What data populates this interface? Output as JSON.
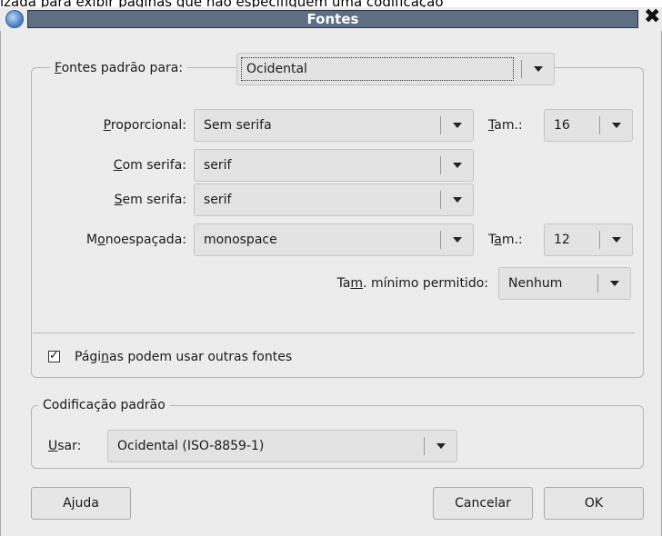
{
  "background_text": "izada para exibir páginas que não especifiquem uma codificação",
  "window": {
    "title": "Fontes",
    "close_glyph": "✖"
  },
  "fonts_group": {
    "legend_prefix": "",
    "legend_key": "F",
    "legend_rest": "ontes padrão para:",
    "for_value": "Ocidental",
    "proportional": {
      "label_key": "P",
      "label_rest": "roporcional:",
      "value": "Sem serifa",
      "size_label_key": "T",
      "size_label_rest": "am.:",
      "size_value": "16"
    },
    "serif": {
      "label_key": "C",
      "label_rest": "om serifa:",
      "value": "serif"
    },
    "sans_serif": {
      "label_key": "S",
      "label_rest": "em serifa:",
      "value": "serif"
    },
    "monospace": {
      "label_pre": "M",
      "label_key": "o",
      "label_rest": "noespaçada:",
      "value": "monospace",
      "size_label_pre": "T",
      "size_label_key": "a",
      "size_label_rest": "m.:",
      "size_value": "12"
    },
    "min_size": {
      "label_pre": "Ta",
      "label_key": "m",
      "label_rest": ". mínimo permitido:",
      "value": "Nenhum"
    },
    "allow_pages_fonts": {
      "label_pre": "Pági",
      "label_key": "n",
      "label_rest": "as podem usar outras fontes",
      "checked": true
    }
  },
  "encoding_group": {
    "legend": "Codificação padrão",
    "use_label_key": "U",
    "use_label_rest": "sar:",
    "value": "Ocidental (ISO-8859-1)"
  },
  "buttons": {
    "help": "Ajuda",
    "cancel": "Cancelar",
    "ok": "OK"
  },
  "icons": {
    "app": "firefox-icon",
    "close": "close-icon",
    "dropdown": "chevron-down-icon",
    "check": "checkmark-icon"
  }
}
